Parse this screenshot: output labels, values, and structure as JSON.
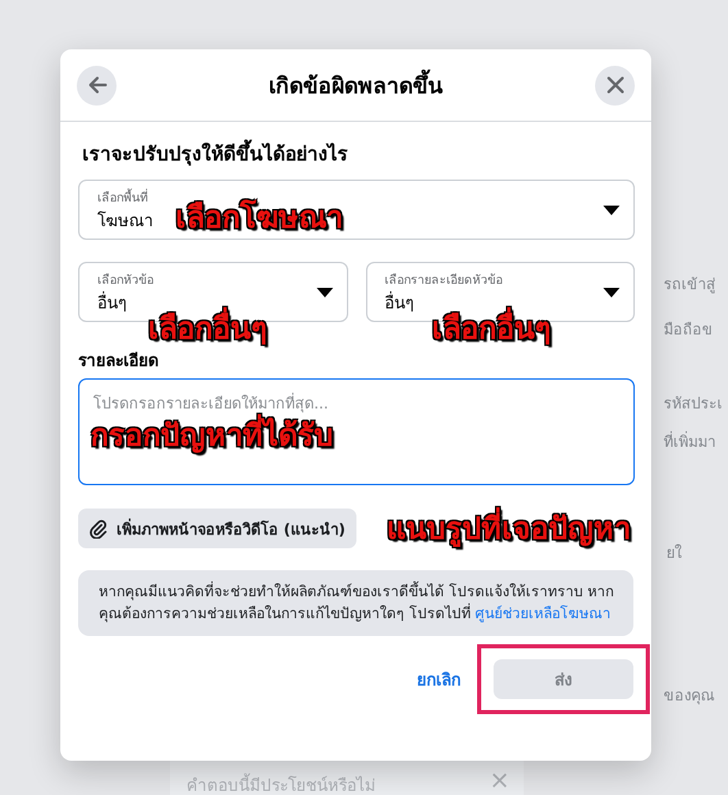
{
  "background": {
    "fragments": [
      "รถเข้าสู่",
      "มือถือข",
      "รหัสประเ",
      "ที่เพิ่มมา",
      "ยใ",
      "ของคุณ"
    ],
    "feedback_card": {
      "text": "คำตอบนี้มีประโยชน์หรือไม่",
      "close": "×"
    }
  },
  "dialog": {
    "title": "เกิดข้อผิดพลาดขึ้น",
    "heading": "เราจะปรับปรุงให้ดีขึ้นได้อย่างไร",
    "selects": [
      {
        "label": "เลือกพื้นที่",
        "value": "โฆษณา"
      },
      {
        "label": "เลือกหัวข้อ",
        "value": "อื่นๆ"
      },
      {
        "label": "เลือกรายละเอียดหัวข้อ",
        "value": "อื่นๆ"
      }
    ],
    "details": {
      "label": "รายละเอียด",
      "placeholder": "โปรดกรอกรายละเอียดให้มากที่สุด..."
    },
    "attach_button": "เพิ่มภาพหน้าจอหรือวิดีโอ (แนะนำ)",
    "info": {
      "text": "หากคุณมีแนวคิดที่จะช่วยทำให้ผลิตภัณฑ์ของเราดีขึ้นได้ โปรดแจ้งให้เราทราบ หากคุณต้องการความช่วยเหลือในการแก้ไขปัญหาใดๆ โปรดไปที่",
      "link": "ศูนย์ช่วยเหลือโฆษณา"
    },
    "cancel_button": "ยกเลิก",
    "submit_button": {
      "label": "ส่ง",
      "disabled": true,
      "highlighted": true
    }
  },
  "annotations": [
    {
      "text": "เลือกโฆษณา"
    },
    {
      "text": "เลือกอื่นๆ"
    },
    {
      "text": "เลือกอื่นๆ"
    },
    {
      "text": "กรอกปัญหาที่ได้รับ"
    },
    {
      "text": "แนบรูปที่เจอปัญหา"
    }
  ]
}
